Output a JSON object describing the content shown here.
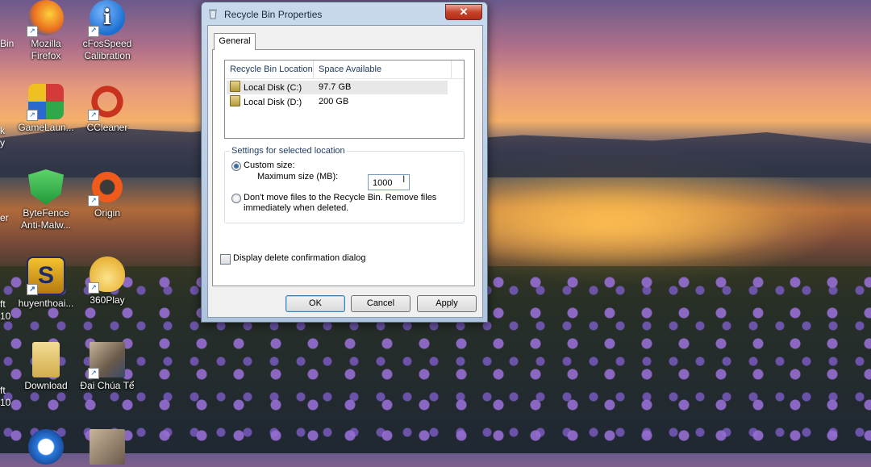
{
  "desktop": {
    "partial_labels": [
      "Bin",
      "k",
      "y",
      "er",
      "ft",
      "10",
      "ft",
      "10"
    ],
    "icons": [
      {
        "label": "Mozilla Firefox",
        "icon": "firefox-icon",
        "color": "#e86b1f"
      },
      {
        "label": "cFosSpeed Calibration",
        "icon": "info-icon",
        "color": "#1a6fd0"
      },
      {
        "label": "GameLaun...",
        "icon": "cube-icon",
        "color": "#d43a3a"
      },
      {
        "label": "CCleaner",
        "icon": "ccleaner-icon",
        "color": "#c9321e"
      },
      {
        "label": "ByteFence Anti-Malw...",
        "icon": "shield-icon",
        "color": "#2fb34a"
      },
      {
        "label": "Origin",
        "icon": "origin-icon",
        "color": "#f05a1a"
      },
      {
        "label": "huyenthoai...",
        "icon": "game-s-icon",
        "color": "#2a3a8a"
      },
      {
        "label": "360Play",
        "icon": "onion-icon",
        "color": "#e9c44a"
      },
      {
        "label": "Download",
        "icon": "folder-icon",
        "color": "#e1c36a"
      },
      {
        "label": "Đại Chúa Tể",
        "icon": "game-portrait-icon",
        "color": "#8a6a4a"
      }
    ]
  },
  "dialog": {
    "title": "Recycle Bin Properties",
    "close_label": "✕",
    "tab": "General",
    "list": {
      "columns": [
        "Recycle Bin Location",
        "Space Available"
      ],
      "rows": [
        {
          "location": "Local Disk (C:)",
          "space": "97.7 GB"
        },
        {
          "location": "Local Disk (D:)",
          "space": "200 GB"
        }
      ]
    },
    "settings": {
      "group_title": "Settings for selected location",
      "custom_size": "Custom size:",
      "max_size_label": "Maximum size (MB):",
      "max_size_value": "1000",
      "dont_move_line1": "Don't move files to the Recycle Bin. Remove files",
      "dont_move_line2": "immediately when deleted."
    },
    "confirm_label": "Display delete confirmation dialog",
    "buttons": {
      "ok": "OK",
      "cancel": "Cancel",
      "apply": "Apply"
    }
  }
}
